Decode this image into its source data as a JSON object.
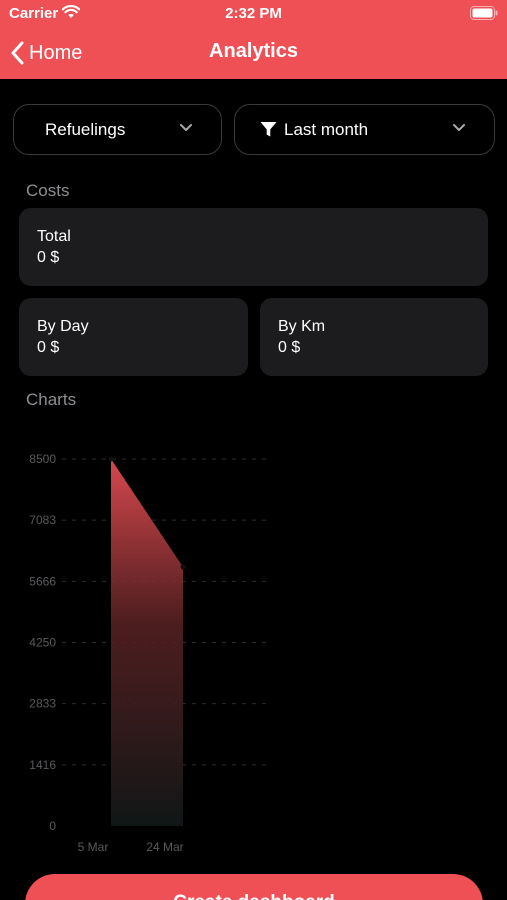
{
  "status_bar": {
    "carrier": "Carrier",
    "time": "2:32 PM"
  },
  "nav": {
    "back_label": "Home",
    "title": "Analytics"
  },
  "filters": {
    "type": "Refuelings",
    "period": "Last month"
  },
  "costs": {
    "section_title": "Costs",
    "total": {
      "label": "Total",
      "value": "0 $"
    },
    "by_day": {
      "label": "By Day",
      "value": "0 $"
    },
    "by_km": {
      "label": "By Km",
      "value": "0 $"
    }
  },
  "charts": {
    "section_title": "Charts"
  },
  "chart_data": {
    "type": "area",
    "x": [
      "5 Mar",
      "24 Mar"
    ],
    "values": [
      8500,
      6000
    ],
    "y_ticks": [
      "8500",
      "7083",
      "5666",
      "4250",
      "2833",
      "1416",
      "0"
    ],
    "ylim": [
      0,
      8500
    ],
    "grid": true,
    "color": "#ef5056"
  },
  "cta": {
    "label": "Create dashboard"
  },
  "colors": {
    "accent": "#ef5056",
    "card": "#1c1c1e",
    "background": "#000000"
  }
}
